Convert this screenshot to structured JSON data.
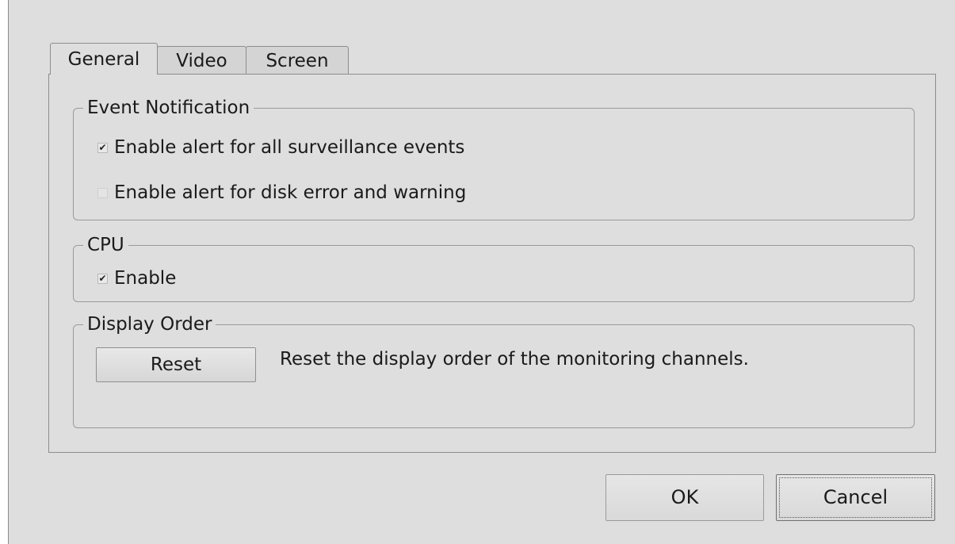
{
  "tabs": [
    {
      "label": "General",
      "active": true
    },
    {
      "label": "Video",
      "active": false
    },
    {
      "label": "Screen",
      "active": false
    }
  ],
  "event_notification": {
    "title": "Event Notification",
    "options": [
      {
        "label": "Enable alert for all surveillance events",
        "checked": true,
        "enabled": true
      },
      {
        "label": "Enable alert for disk error and warning",
        "checked": false,
        "enabled": false
      }
    ]
  },
  "cpu": {
    "title": "CPU",
    "enable_label": "Enable",
    "enable_checked": true
  },
  "display_order": {
    "title": "Display Order",
    "reset_label": "Reset",
    "description": "Reset the display order of the monitoring channels."
  },
  "buttons": {
    "ok_label": "OK",
    "cancel_label": "Cancel"
  },
  "icons": {
    "check": "✔"
  }
}
